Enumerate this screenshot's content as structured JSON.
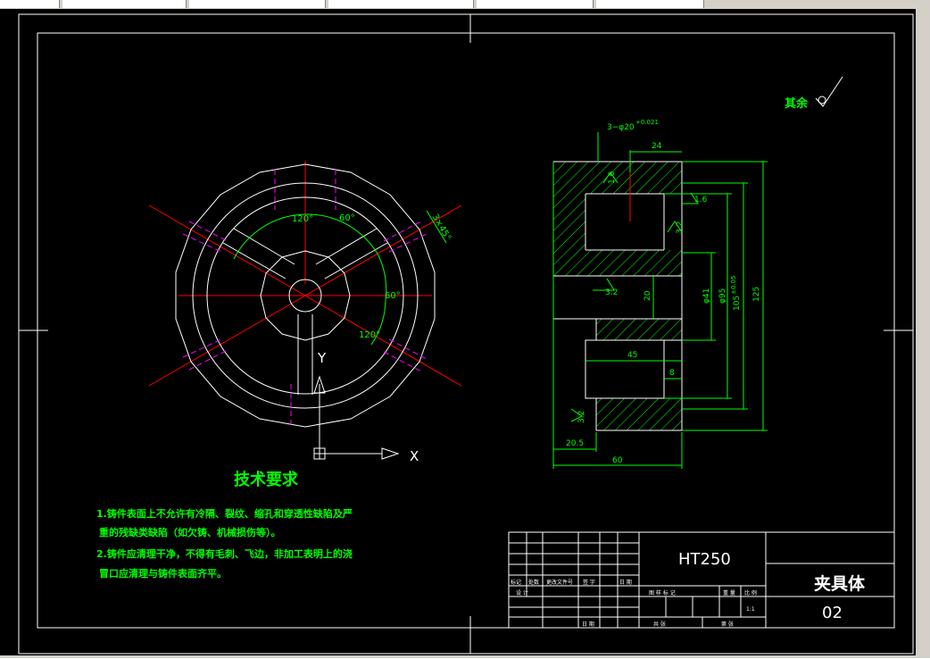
{
  "colors": {
    "background": "#000000",
    "line": "#ffffff",
    "dimension": "#00ff00",
    "centerline": "#ff0000",
    "hidden": "#ff00ff",
    "text": "#00ff00"
  },
  "roughness": {
    "label": "其余"
  },
  "drawing_front": {
    "angles": [
      "120°",
      "60°",
      "60°",
      "120°"
    ],
    "chamfer": "3×45°",
    "axis_y": "Y",
    "axis_x": "X"
  },
  "drawing_section": {
    "dims": {
      "holes": "3−φ20",
      "holes_tol": "+0.021",
      "d24": "24",
      "r16a": "1.6",
      "r16b": "1.6",
      "r32a": "3.2",
      "r32b": "3.2",
      "r32c": "3.2",
      "d20": "20",
      "d41": "φ41",
      "d95": "φ95",
      "d105": "105",
      "d105tol": "±0.05",
      "d125": "125",
      "d45": "45",
      "d8": "8",
      "d205": "20.5",
      "d60": "60"
    }
  },
  "requirements": {
    "title": "技术要求",
    "line1": "1.铸件表面上不允许有冷隔、裂纹、缩孔和穿透性缺陷及严",
    "line2": "重的残缺类缺陷（如欠铸、机械损伤等）。",
    "line3": "2.铸件应清理干净，不得有毛刺、飞边，非加工表明上的浇",
    "line4": "冒口应清理与铸件表面齐平。"
  },
  "title_block": {
    "material": "HT250",
    "part_name": "夹具体",
    "drawing_no": "02",
    "scale": "1:1",
    "h_biaoji": "标记",
    "h_chushu": "处数",
    "h_wenjian": "更改文件号",
    "h_qianzi": "签 字",
    "h_riqi": "日 期",
    "h_sheji": "设 计",
    "h_tuyang": "图 样 标 记",
    "h_zhongliang": "重 量",
    "h_bili": "比 例",
    "h_gong": "共 张",
    "h_di": "第 张",
    "h_date": "日 期"
  }
}
